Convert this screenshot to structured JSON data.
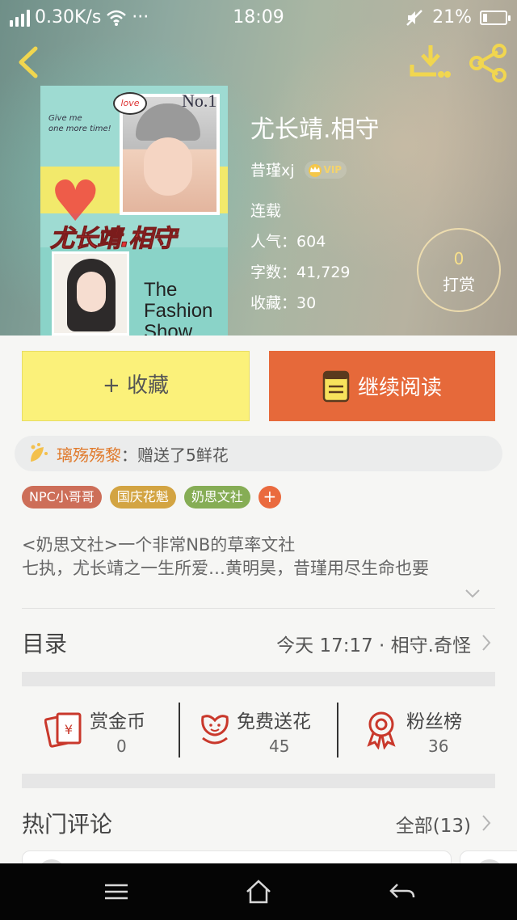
{
  "status_bar": {
    "speed": "0.30K/s",
    "more": "···",
    "time": "18:09",
    "battery": "21%",
    "battery_level": 0.21
  },
  "book": {
    "title": "尤长靖.相守",
    "author": "昔瑾xj",
    "vip": "VIP",
    "status": "连载",
    "popularity_label": "人气：",
    "popularity": "604",
    "words_label": "字数：",
    "words": "41,729",
    "favorites_label": "收藏：",
    "favorites": "30"
  },
  "cover": {
    "number": "No.1",
    "love": "love",
    "give_line1": "Give me",
    "give_line2": "one more time!",
    "title": "尤长靖.相守",
    "fashion_line1": "The",
    "fashion_line2": "Fashion",
    "fashion_line3": "Show"
  },
  "reward": {
    "count": "0",
    "label": "打赏"
  },
  "actions": {
    "collect": "+ 收藏",
    "read": "继续阅读"
  },
  "gift": {
    "user": "璃殇殇黎",
    "separator": "：",
    "text": "赠送了5鲜花"
  },
  "tags": [
    "NPC小哥哥",
    "国庆花魁",
    "奶思文社"
  ],
  "tag_add": "+",
  "description": {
    "line1": "<奶思文社>一个非常NB的草率文社",
    "line2": "七执，尤长靖之一生所爱…黄明昊，昔瑾用尽生命也要"
  },
  "toc": {
    "title": "目录",
    "latest": "今天 17:17 · 相守.奇怪"
  },
  "stats": [
    {
      "label": "赏金币",
      "value": "0",
      "icon": "red-envelope-icon"
    },
    {
      "label": "免费送花",
      "value": "45",
      "icon": "flower-icon"
    },
    {
      "label": "粉丝榜",
      "value": "36",
      "icon": "ribbon-medal-icon"
    }
  ],
  "comments": {
    "title": "热门评论",
    "all": "全部(13)"
  },
  "colors": {
    "collect_bg": "#fbf17a",
    "read_bg": "#e6693a",
    "gift_user": "#e07a2c",
    "tag1": "#cd6e58",
    "tag2": "#d3a442",
    "tag3": "#86ad55",
    "icon_red": "#c9382b"
  }
}
